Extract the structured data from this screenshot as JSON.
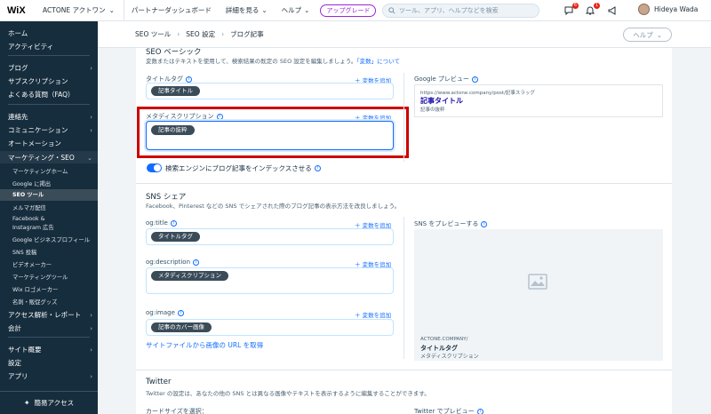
{
  "topbar": {
    "logo": "WiX",
    "site_name": "ACTONE アクトワン",
    "nav": [
      "パートナーダッシュボード",
      "詳細を見る",
      "ヘルプ"
    ],
    "upgrade": "アップグレード",
    "search_placeholder": "ツール、アプリ、ヘルプなどを検索",
    "chat_badge": "6",
    "bell_badge": "1",
    "user_name": "Hideya Wada"
  },
  "sidebar": {
    "items": [
      "ホーム",
      "アクティビティ",
      "ブログ",
      "サブスクリプション",
      "よくある質問（FAQ）",
      "連絡先",
      "コミュニケーション",
      "オートメーション",
      "マーケティング・SEO"
    ],
    "sub_items": [
      "マーケティングホーム",
      "Google に掲出",
      "SEO ツール",
      "メルマガ配信",
      "Facebook &",
      "Instagram 広告",
      "Google ビジネスプロフィール",
      "SNS 投稿",
      "ビデオメーカー",
      "マーケティングツール",
      "Wix ロゴメーカー",
      "名刺・販促グッズ"
    ],
    "items_after": [
      "アクセス解析・レポート",
      "会計",
      "サイト概要",
      "設定",
      "アプリ"
    ],
    "bottom": "簡易アクセス"
  },
  "breadcrumb": [
    "SEO ツール",
    "SEO 設定",
    "ブログ記事"
  ],
  "help": "ヘルプ",
  "seo": {
    "section_title": "SEO ベーシック",
    "desc_prefix": "変数またはテキストを使用して、検索結果の既定の SEO 設定を編集しましょう。",
    "desc_link": "「変数」について",
    "title_tag_label": "タイトルタグ",
    "add_var": "＋ 変数を追加",
    "title_chip": "記事タイトル",
    "meta_label": "メタディスクリプション",
    "meta_chip": "記事の抜粋",
    "index_label": "検索エンジンにブログ記事をインデックスさせる",
    "google_preview_label": "Google プレビュー",
    "preview_url": "https://www.actone.company/post/記事スラッグ",
    "preview_title": "記事タイトル",
    "preview_desc": "記事の抜粋"
  },
  "sns": {
    "section_title": "SNS シェア",
    "desc": "Facebook、Pinterest などの SNS でシェアされた際のブログ記事の表示方法を改良しましょう。",
    "og_title_label": "og:title",
    "og_title_chip": "タイトルタグ",
    "og_desc_label": "og:description",
    "og_desc_chip": "メタディスクリプション",
    "og_image_label": "og:image",
    "og_image_chip": "記事のカバー画像",
    "image_link": "サイトファイルから画像の URL を取得",
    "preview_label": "SNS をプレビューする",
    "preview_domain": "ACTONE.COMPANY/",
    "preview_title": "タイトルタグ",
    "preview_desc": "メタディスクリプション"
  },
  "twitter": {
    "section_title": "Twitter",
    "desc": "Twitter の設定は、あなたの他の SNS とは異なる画像やテキストを表示するように編集することができます。",
    "card_size_label": "カードサイズを選択：",
    "preview_label": "Twitter でプレビュー"
  }
}
